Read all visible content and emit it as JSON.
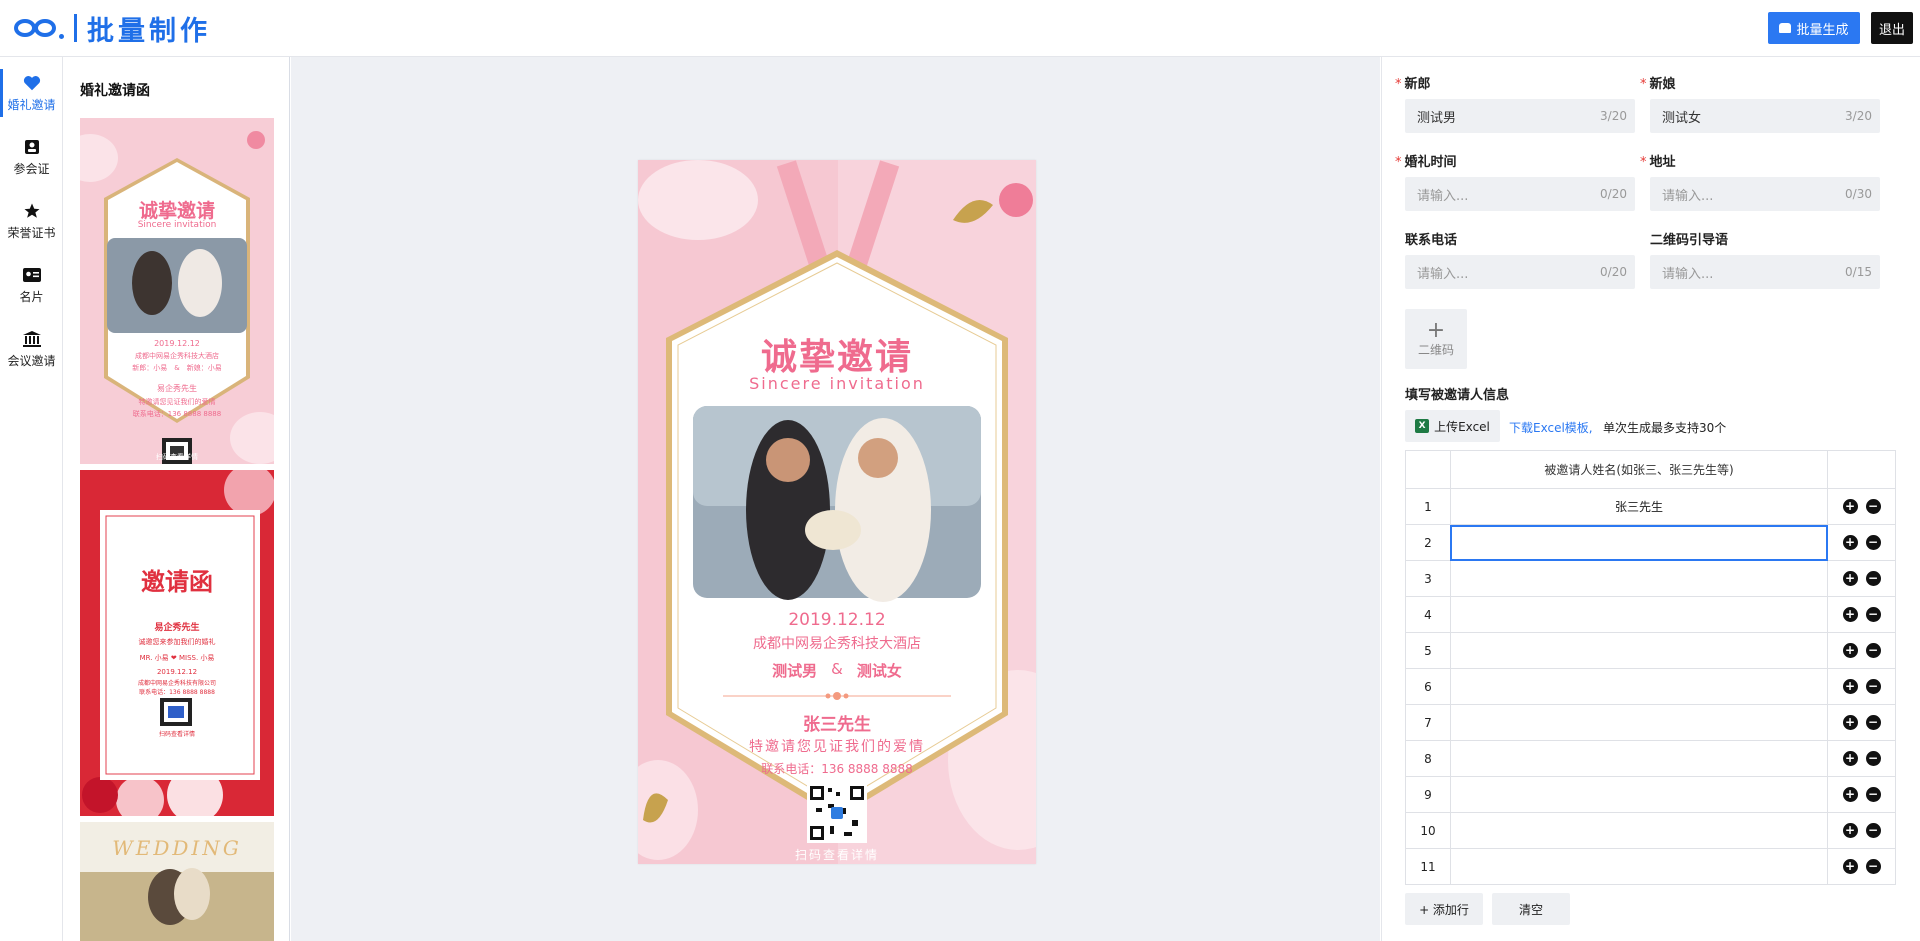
{
  "header": {
    "logo_text": "批量制作",
    "batch_button": "批量生成",
    "exit_button": "退出"
  },
  "nav": {
    "items": [
      {
        "label": "婚礼邀请",
        "icon": "heart-icon"
      },
      {
        "label": "参会证",
        "icon": "badge-icon"
      },
      {
        "label": "荣誉证书",
        "icon": "star-icon"
      },
      {
        "label": "名片",
        "icon": "id-card-icon"
      },
      {
        "label": "会议邀请",
        "icon": "bank-icon"
      }
    ]
  },
  "templates": {
    "title": "婚礼邀请函",
    "t1": {
      "title": "诚挚邀请",
      "subtitle": "Sincere invitation",
      "date": "2019.12.12",
      "venue": "成都中网易企秀科技大酒店",
      "couple": "新郎：小易　&　新娘：小易",
      "guest": "易企秀先生",
      "invite": "特邀请您见证我们的爱情",
      "phone": "联系电话：136 8888 8888",
      "scan": "扫码查看详情"
    },
    "t2": {
      "title": "邀请函",
      "guest": "易企秀先生",
      "line1": "诚邀您来参加我们的婚礼",
      "couple": "MR. 小易 ❤ MISS. 小易",
      "date": "2019.12.12",
      "venue": "成都中网易企秀科技有限公司",
      "phone": "联系电话：136 8888 8888",
      "scan": "扫码查看详情"
    },
    "t3": {
      "title": "WEDDING"
    }
  },
  "card": {
    "title": "诚挚邀请",
    "subtitle": "Sincere invitation",
    "date": "2019.12.12",
    "venue": "成都中网易企秀科技大酒店",
    "groom": "测试男",
    "amp": "&",
    "bride": "测试女",
    "guest": "张三先生",
    "invite": "特邀请您见证我们的爱情",
    "phone": "联系电话：136 8888 8888",
    "scan": "扫码查看详情"
  },
  "form": {
    "groom_label": "新郎",
    "groom_value": "测试男",
    "groom_count": "3/20",
    "bride_label": "新娘",
    "bride_value": "测试女",
    "bride_count": "3/20",
    "time_label": "婚礼时间",
    "time_placeholder": "请输入...",
    "time_count": "0/20",
    "addr_label": "地址",
    "addr_placeholder": "请输入...",
    "addr_count": "0/30",
    "phone_label": "联系电话",
    "phone_placeholder": "请输入...",
    "phone_count": "0/20",
    "qrtip_label": "二维码引导语",
    "qrtip_placeholder": "请输入...",
    "qrtip_count": "0/15",
    "qr_upload_plus": "+",
    "qr_upload_label": "二维码",
    "section_title": "填写被邀请人信息",
    "upload_excel": "上传Excel",
    "excel_icon": "X",
    "download_link": "下载Excel模板,",
    "download_note": "单次生成最多支持30个",
    "table_header": "被邀请人姓名(如张三、张三先生等)",
    "rows": [
      {
        "idx": "1",
        "name": "张三先生"
      },
      {
        "idx": "2",
        "name": ""
      },
      {
        "idx": "3",
        "name": ""
      },
      {
        "idx": "4",
        "name": ""
      },
      {
        "idx": "5",
        "name": ""
      },
      {
        "idx": "6",
        "name": ""
      },
      {
        "idx": "7",
        "name": ""
      },
      {
        "idx": "8",
        "name": ""
      },
      {
        "idx": "9",
        "name": ""
      },
      {
        "idx": "10",
        "name": ""
      },
      {
        "idx": "11",
        "name": ""
      }
    ],
    "add_row": "+ 添加行",
    "clear": "清空"
  }
}
